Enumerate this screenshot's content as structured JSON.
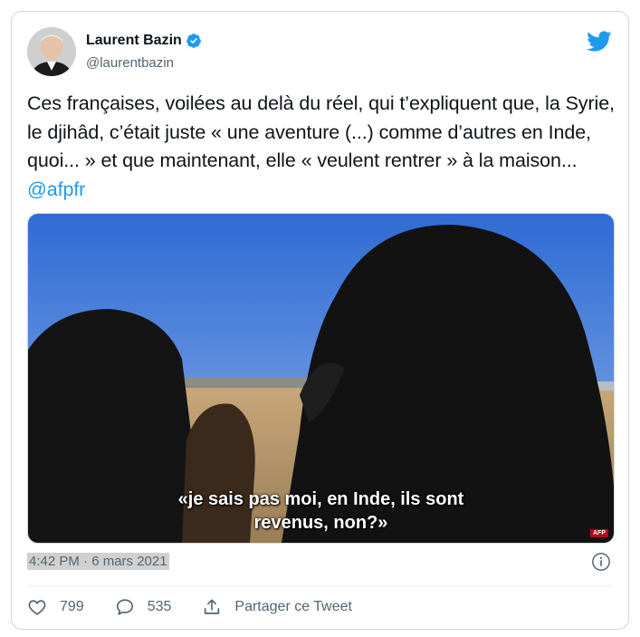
{
  "author": {
    "name": "Laurent Bazin",
    "handle": "@laurentbazin"
  },
  "tweet": {
    "text": "Ces françaises, voilées au delà du réel, qui t’expliquent que, la Syrie, le djihâd, c’était juste « une aventure (...) comme d’autres en Inde, quoi... » et que maintenant, elle « veulent rentrer » à la maison...",
    "mention": "@afpfr",
    "timestamp": "4:42 PM · 6 mars 2021"
  },
  "media": {
    "subtitle_line1": "«je sais pas moi, en Inde, ils sont",
    "subtitle_line2": "revenus, non?»",
    "watermark": "AFP"
  },
  "actions": {
    "likes": "799",
    "replies": "535",
    "share_label": "Partager ce Tweet"
  },
  "colors": {
    "accent": "#1d9bf0",
    "text_secondary": "#536471",
    "border": "#cfd9de"
  },
  "icons": {
    "verified": "verified-badge-icon",
    "brand": "twitter-bird-icon",
    "info": "info-icon",
    "like": "heart-icon",
    "reply": "speech-bubble-icon",
    "share": "share-upload-icon"
  }
}
